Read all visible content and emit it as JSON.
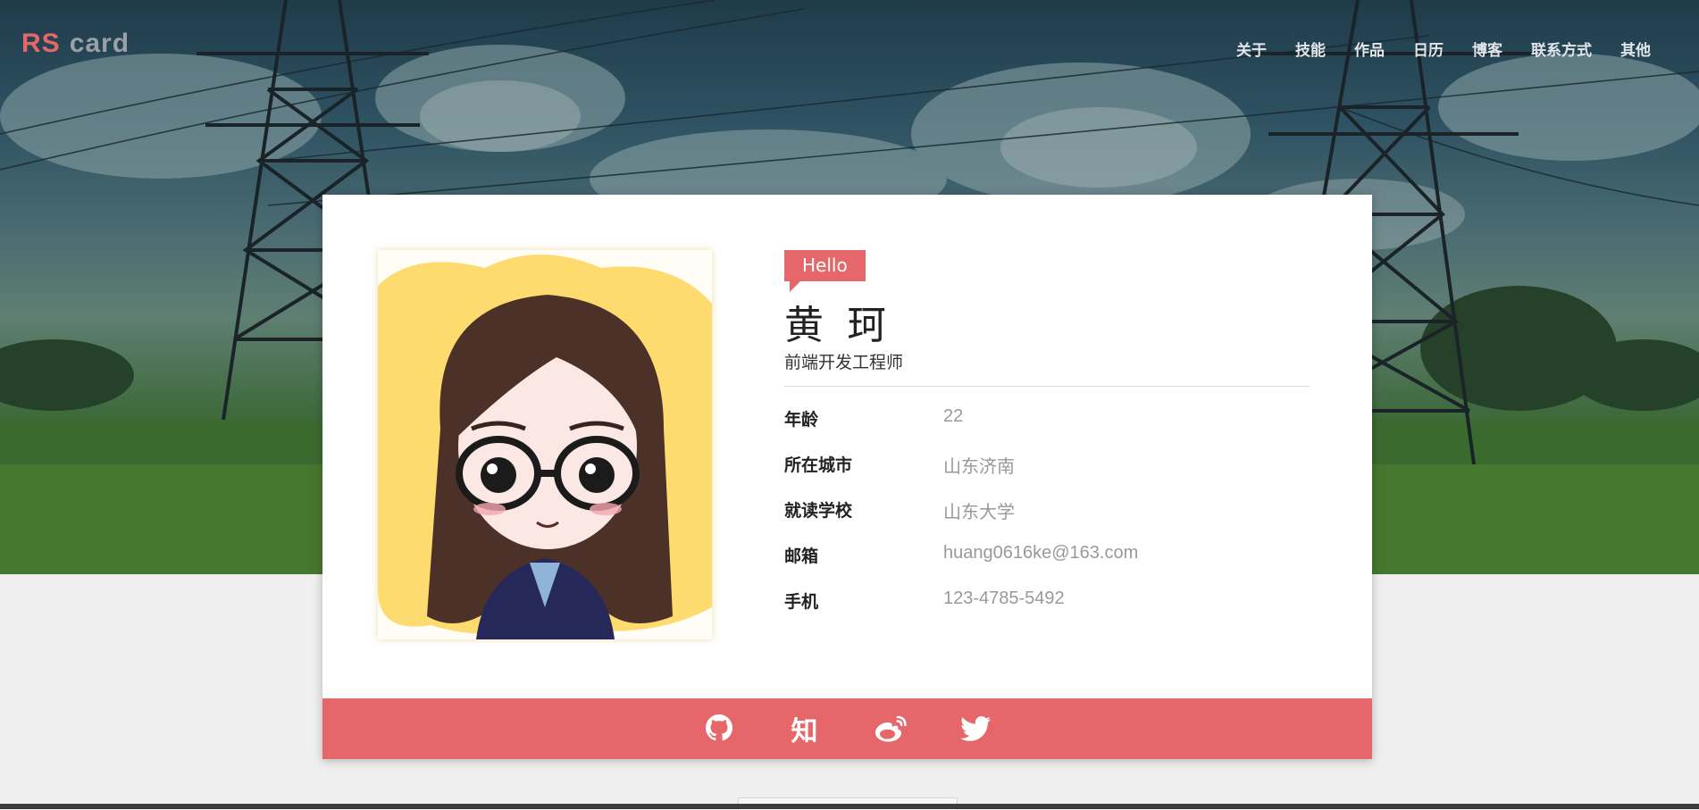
{
  "brand": {
    "part1": "RS",
    "part2": "card"
  },
  "nav": [
    {
      "label": "关于"
    },
    {
      "label": "技能"
    },
    {
      "label": "作品"
    },
    {
      "label": "日历"
    },
    {
      "label": "博客"
    },
    {
      "label": "联系方式"
    },
    {
      "label": "其他"
    }
  ],
  "profile": {
    "greeting": "Hello",
    "name": "黄 珂",
    "title": "前端开发工程师",
    "fields": [
      {
        "label": "年龄",
        "value": "22"
      },
      {
        "label": "所在城市",
        "value": "山东济南"
      },
      {
        "label": "就读学校",
        "value": "山东大学"
      },
      {
        "label": "邮箱",
        "value": "huang0616ke@163.com"
      },
      {
        "label": "手机",
        "value": "123-4785-5492"
      }
    ]
  },
  "social": [
    {
      "icon": "github-icon"
    },
    {
      "icon": "zhihu-icon",
      "text": "知"
    },
    {
      "icon": "weibo-icon"
    },
    {
      "icon": "twitter-icon"
    }
  ],
  "colors": {
    "accent": "#e5676a",
    "card": "#ffffff",
    "page_bg": "#efefef"
  }
}
